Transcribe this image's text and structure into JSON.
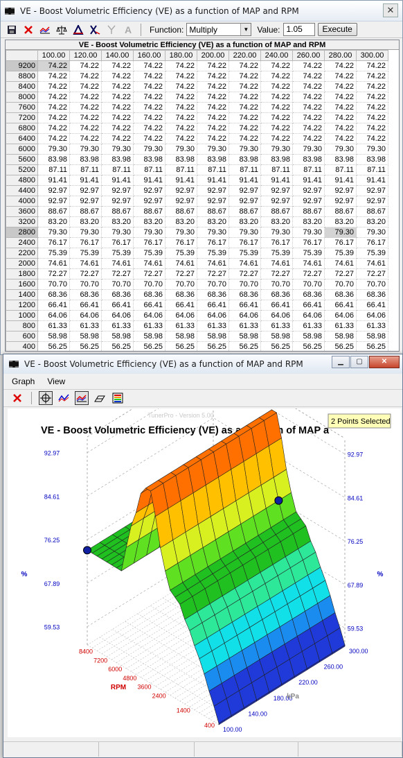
{
  "table_window": {
    "title": "VE - Boost Volumetric Efficiency (VE) as a function of MAP and RPM",
    "close_label": "✕",
    "toolbar": {
      "function_label": "Function:",
      "function_value": "Multiply",
      "value_label": "Value:",
      "value": "1.05",
      "execute_label": "Execute"
    },
    "table_title": "VE - Boost Volumetric Efficiency (VE) as a function of MAP and RPM",
    "columns": [
      "100.00",
      "120.00",
      "140.00",
      "160.00",
      "180.00",
      "200.00",
      "220.00",
      "240.00",
      "260.00",
      "280.00",
      "300.00"
    ],
    "rows": [
      {
        "rpm": "9200",
        "val": "74.22"
      },
      {
        "rpm": "8800",
        "val": "74.22"
      },
      {
        "rpm": "8400",
        "val": "74.22"
      },
      {
        "rpm": "8000",
        "val": "74.22"
      },
      {
        "rpm": "7600",
        "val": "74.22"
      },
      {
        "rpm": "7200",
        "val": "74.22"
      },
      {
        "rpm": "6800",
        "val": "74.22"
      },
      {
        "rpm": "6400",
        "val": "74.22"
      },
      {
        "rpm": "6000",
        "val": "79.30"
      },
      {
        "rpm": "5600",
        "val": "83.98"
      },
      {
        "rpm": "5200",
        "val": "87.11"
      },
      {
        "rpm": "4800",
        "val": "91.41"
      },
      {
        "rpm": "4400",
        "val": "92.97"
      },
      {
        "rpm": "4000",
        "val": "92.97"
      },
      {
        "rpm": "3600",
        "val": "88.67"
      },
      {
        "rpm": "3200",
        "val": "83.20"
      },
      {
        "rpm": "2800",
        "val": "79.30"
      },
      {
        "rpm": "2400",
        "val": "76.17"
      },
      {
        "rpm": "2200",
        "val": "75.39"
      },
      {
        "rpm": "2000",
        "val": "74.61"
      },
      {
        "rpm": "1800",
        "val": "72.27"
      },
      {
        "rpm": "1600",
        "val": "70.70"
      },
      {
        "rpm": "1400",
        "val": "68.36"
      },
      {
        "rpm": "1200",
        "val": "66.41"
      },
      {
        "rpm": "1000",
        "val": "64.06"
      },
      {
        "rpm": "800",
        "val": "61.33"
      },
      {
        "rpm": "600",
        "val": "58.98"
      },
      {
        "rpm": "400",
        "val": "56.25"
      }
    ]
  },
  "graph_window": {
    "title": "VE - Boost Volumetric Efficiency (VE) as a function of MAP and RPM",
    "menu": [
      "Graph",
      "View"
    ],
    "watermark": "TunerPro - Version 5.00",
    "plot_title": "VE - Boost Volumetric Efficiency (VE) as a function of MAP a",
    "selection_badge": "2 Points Selected",
    "z_ticks": [
      "92.97",
      "84.61",
      "76.25",
      "67.89",
      "59.53"
    ],
    "z_unit": "%",
    "rpm_ticks": [
      "8400",
      "7200",
      "6000",
      "4800",
      "3600",
      "2400",
      "1400",
      "400"
    ],
    "rpm_label": "RPM",
    "kpa_ticks": [
      "300.00",
      "260.00",
      "220.00",
      "180.00",
      "140.00",
      "100.00"
    ],
    "kpa_label": "kPa"
  },
  "colors": {
    "axis_blue": "#0000c0",
    "axis_red": "#d00000",
    "marker": "#1020a0"
  }
}
